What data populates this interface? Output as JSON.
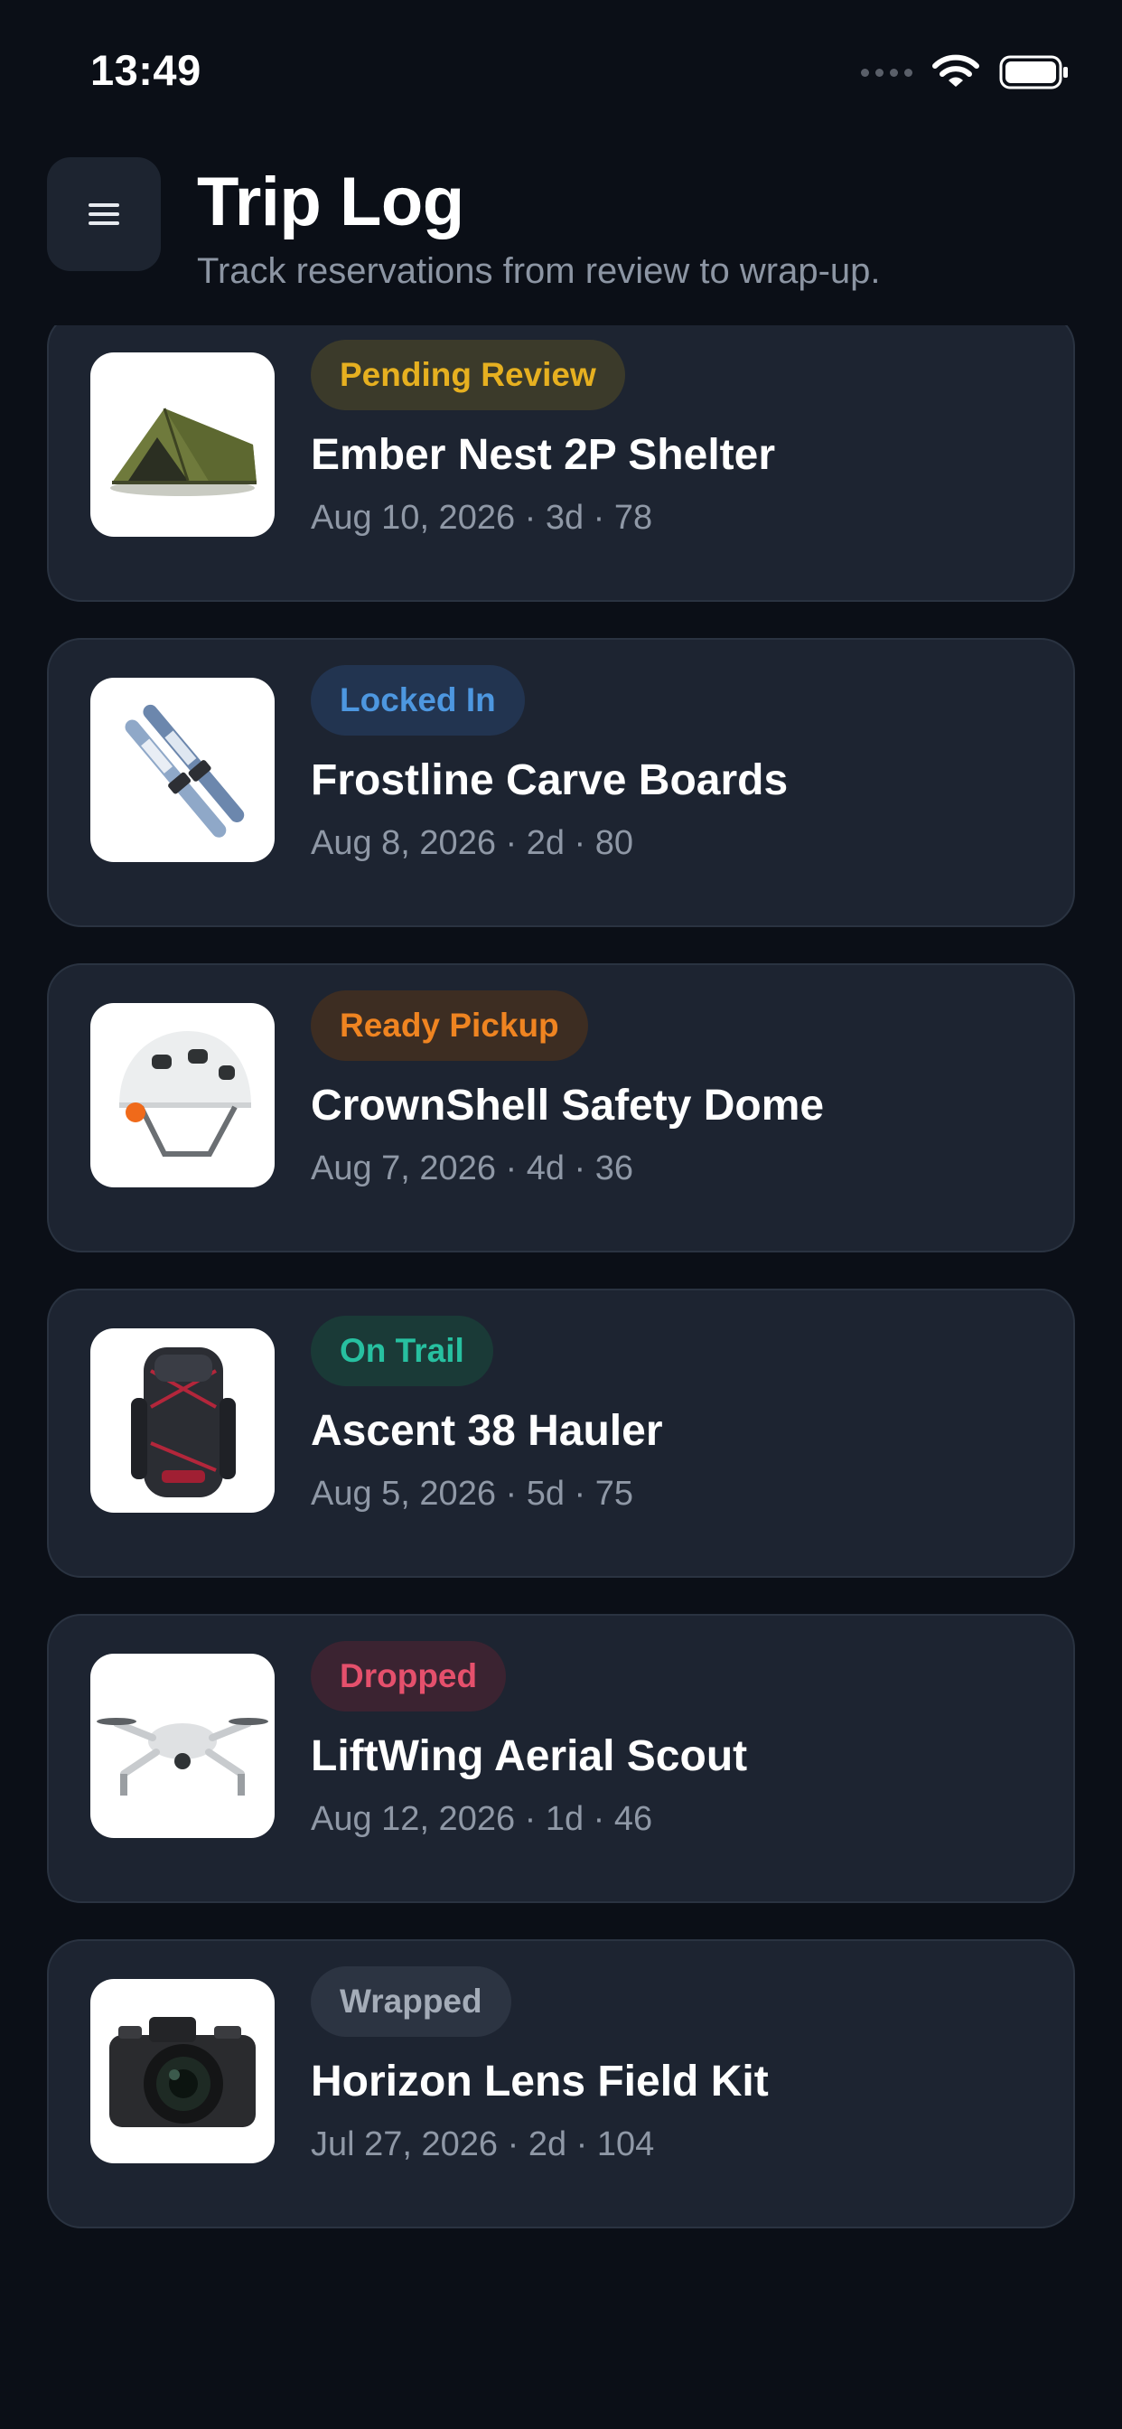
{
  "status_bar": {
    "time": "13:49"
  },
  "header": {
    "title": "Trip Log",
    "subtitle": "Track reservations from review to wrap-up."
  },
  "items": [
    {
      "status": "Pending Review",
      "name": "Ember Nest 2P Shelter",
      "meta": "Aug 10, 2026 · 3d · 78",
      "status_color": "#e6b020",
      "status_bg": "#3b3a2a",
      "thumb_icon": "tent-icon"
    },
    {
      "status": "Locked In",
      "name": "Frostline Carve Boards",
      "meta": "Aug 8, 2026 · 2d · 80",
      "status_color": "#4d97e0",
      "status_bg": "#223450",
      "thumb_icon": "skis-icon"
    },
    {
      "status": "Ready Pickup",
      "name": "CrownShell Safety Dome",
      "meta": "Aug 7, 2026 · 4d · 36",
      "status_color": "#ef8421",
      "status_bg": "#3d2d22",
      "thumb_icon": "helmet-icon"
    },
    {
      "status": "On Trail",
      "name": "Ascent 38 Hauler",
      "meta": "Aug 5, 2026 · 5d · 75",
      "status_color": "#27c0a0",
      "status_bg": "#1a3a37",
      "thumb_icon": "backpack-icon"
    },
    {
      "status": "Dropped",
      "name": "LiftWing Aerial Scout",
      "meta": "Aug 12, 2026 · 1d · 46",
      "status_color": "#e5506c",
      "status_bg": "#3b2331",
      "thumb_icon": "drone-icon"
    },
    {
      "status": "Wrapped",
      "name": "Horizon Lens Field Kit",
      "meta": "Jul 27, 2026 · 2d · 104",
      "status_color": "#a4acb8",
      "status_bg": "#2c3442",
      "thumb_icon": "camera-icon"
    }
  ]
}
